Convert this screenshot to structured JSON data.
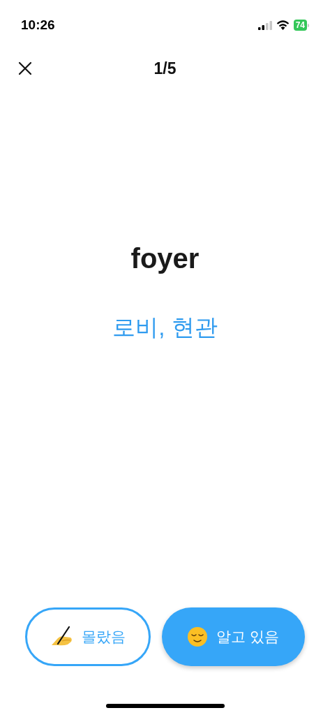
{
  "status_bar": {
    "time": "10:26",
    "battery": "74"
  },
  "header": {
    "progress": "1/5"
  },
  "card": {
    "word": "foyer",
    "meaning": "로비, 현관"
  },
  "buttons": [
    {
      "kind": "outline",
      "label": "몰랐음"
    },
    {
      "kind": "filled",
      "label": "알고 있음"
    }
  ]
}
